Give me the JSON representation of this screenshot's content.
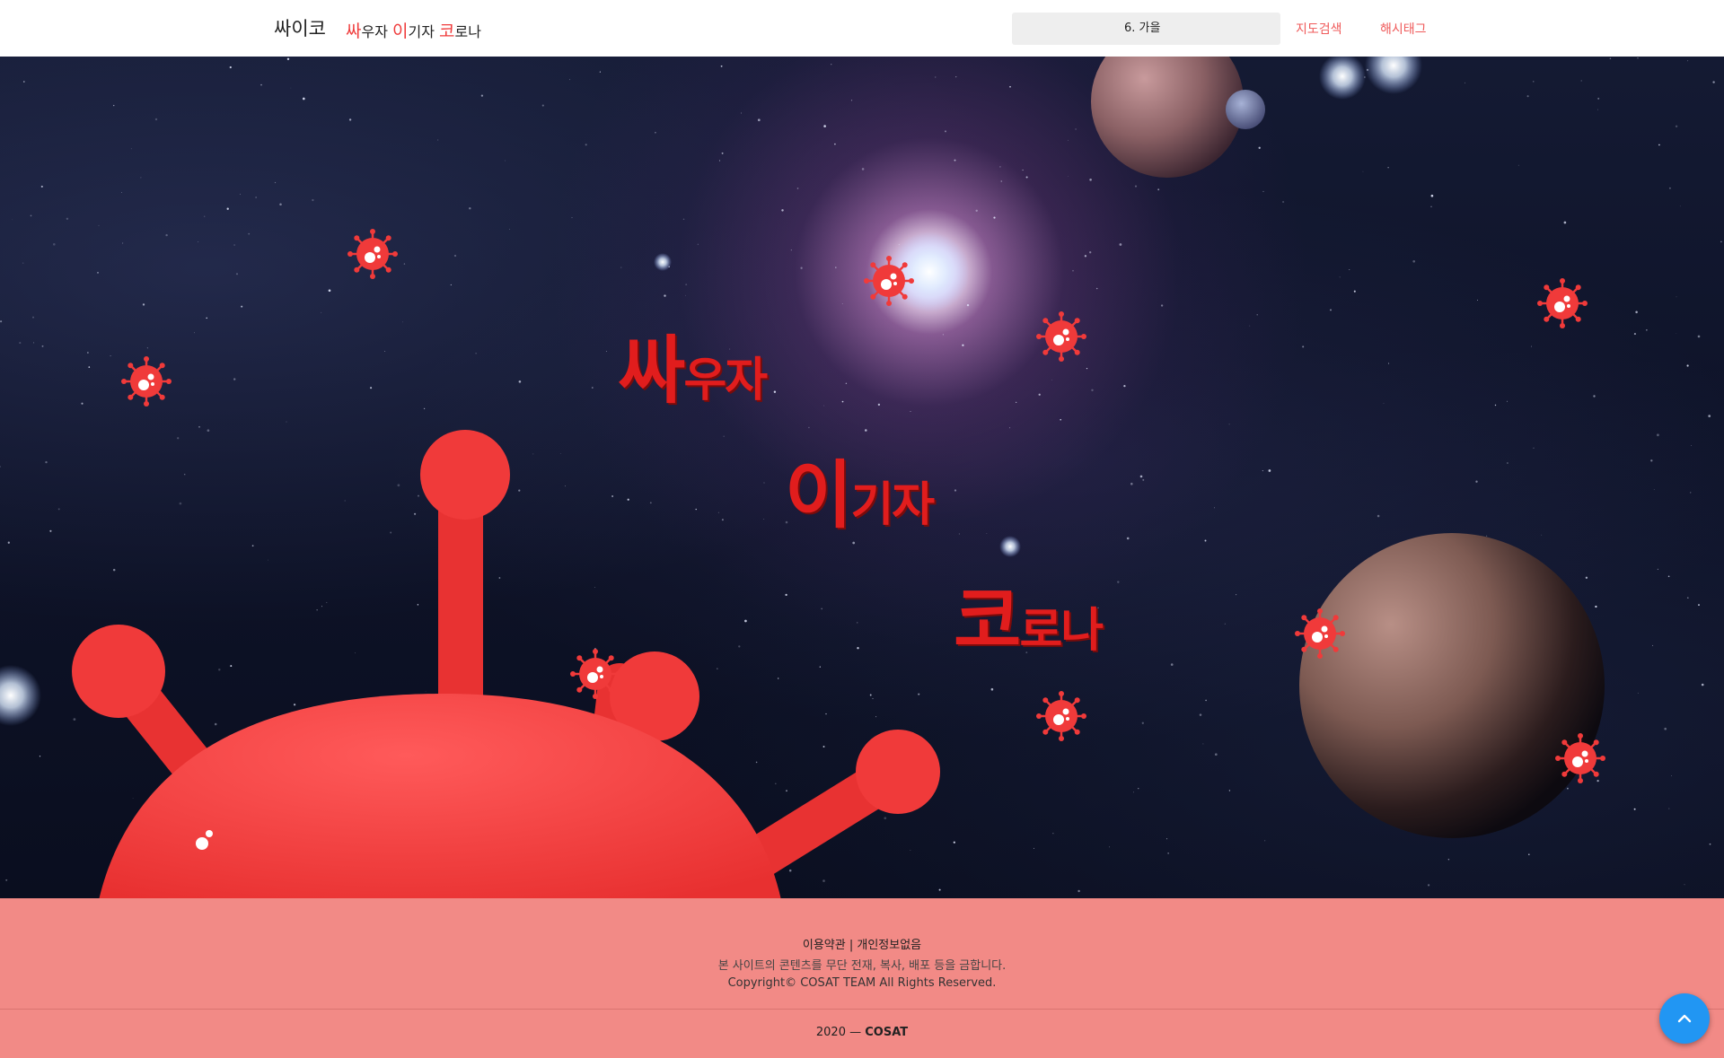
{
  "navbar": {
    "brand": "싸이코",
    "tagline": [
      {
        "hl": "싸",
        "rest": "우자 "
      },
      {
        "hl": "이",
        "rest": "기자 "
      },
      {
        "hl": "코",
        "rest": "로나"
      }
    ],
    "search_value": "6. 가을",
    "links": {
      "map": "지도검색",
      "hashtag": "해시태그"
    }
  },
  "hero": {
    "slogan": [
      {
        "big": "싸",
        "small": "우자"
      },
      {
        "big": "이",
        "small": "기자"
      },
      {
        "big": "코",
        "small": "로나"
      }
    ]
  },
  "footer": {
    "terms": "이용약관 | 개인정보없음",
    "notice": "본 사이트의 콘텐츠를 무단 전재, 복사, 배포 등을 금합니다.",
    "copyright": "Copyright© COSAT TEAM All Rights Reserved.",
    "year": "2020 —",
    "team": "COSAT"
  },
  "colors": {
    "accent": "#ef3b3b",
    "footer_bg": "#f28a86",
    "top_button": "#2196f3",
    "virus": "#f03a3a"
  },
  "icons": {
    "top_button": "chevron-up-icon",
    "virus": "virus-icon"
  }
}
